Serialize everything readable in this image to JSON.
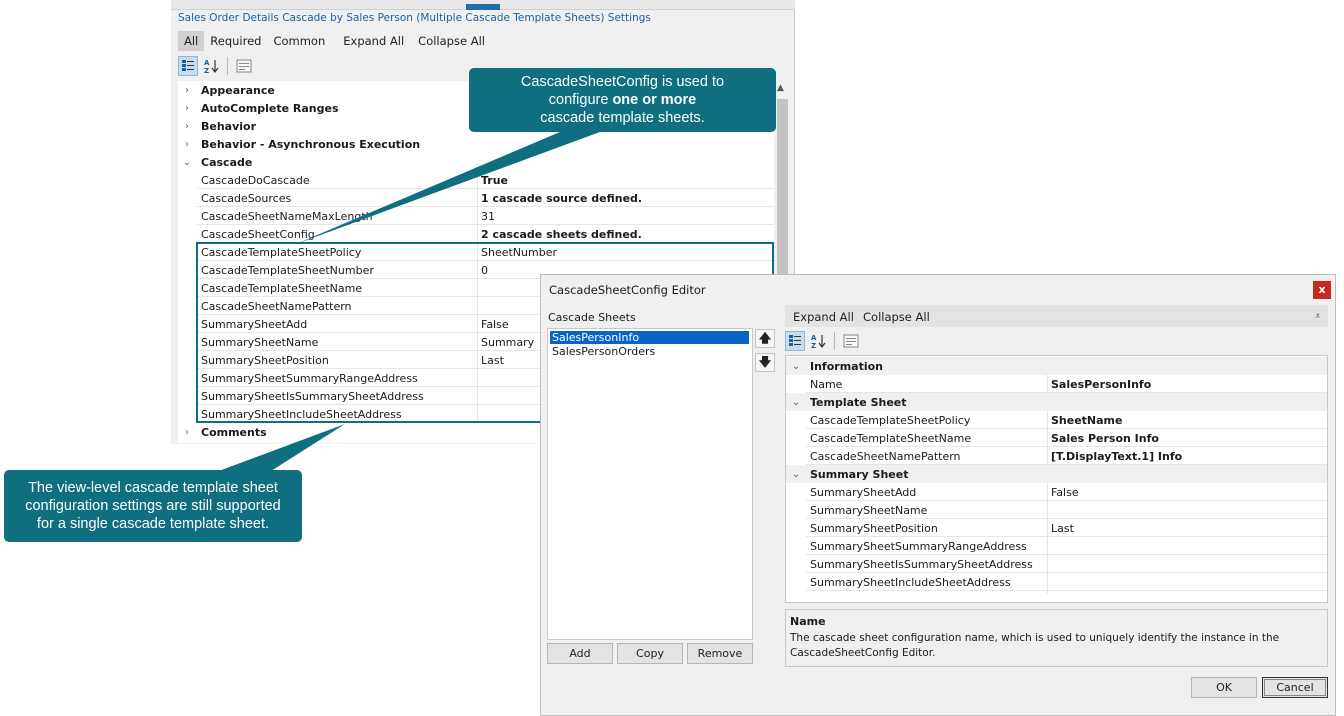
{
  "panel": {
    "title": "Sales Order Details Cascade by Sales Person (Multiple Cascade Template Sheets) Settings",
    "tabs": [
      "All",
      "Required",
      "Common",
      "Expand All",
      "Collapse All"
    ],
    "categories": {
      "appearance": "Appearance",
      "autocomplete": "AutoComplete Ranges",
      "behavior": "Behavior",
      "behavior_async": "Behavior - Asynchronous Execution",
      "cascade": "Cascade",
      "comments": "Comments"
    },
    "properties": [
      {
        "name": "CascadeDoCascade",
        "value": "True",
        "bold": true
      },
      {
        "name": "CascadeSources",
        "value": "1 cascade source defined.",
        "bold": true
      },
      {
        "name": "CascadeSheetNameMaxLength",
        "value": "31",
        "bold": false
      },
      {
        "name": "CascadeSheetConfig",
        "value": "2 cascade sheets defined.",
        "bold": true
      },
      {
        "name": "CascadeTemplateSheetPolicy",
        "value": "SheetNumber",
        "bold": false
      },
      {
        "name": "CascadeTemplateSheetNumber",
        "value": "0",
        "bold": false
      },
      {
        "name": "CascadeTemplateSheetName",
        "value": "",
        "bold": false
      },
      {
        "name": "CascadeSheetNamePattern",
        "value": "",
        "bold": false
      },
      {
        "name": "SummarySheetAdd",
        "value": "False",
        "bold": false
      },
      {
        "name": "SummarySheetName",
        "value": "Summary",
        "bold": false
      },
      {
        "name": "SummarySheetPosition",
        "value": "Last",
        "bold": false
      },
      {
        "name": "SummarySheetSummaryRangeAddress",
        "value": "",
        "bold": false
      },
      {
        "name": "SummarySheetIsSummarySheetAddress",
        "value": "",
        "bold": false
      },
      {
        "name": "SummarySheetIncludeSheetAddress",
        "value": "",
        "bold": false
      }
    ]
  },
  "callouts": {
    "top_line1": "CascadeSheetConfig is used to",
    "top_line2_pre": "configure ",
    "top_line2_bold": "one or more",
    "top_line3": "cascade template sheets.",
    "bottom_line1": "The view-level cascade template sheet",
    "bottom_line2": "configuration settings are still supported",
    "bottom_line3": "for a single cascade template sheet."
  },
  "dialog": {
    "title": "CascadeSheetConfig Editor",
    "close_label": "x",
    "list_label": "Cascade Sheets",
    "sheets": [
      "SalesPersonInfo",
      "SalesPersonOrders"
    ],
    "add_label": "Add",
    "copy_label": "Copy",
    "remove_label": "Remove",
    "expand_all": "Expand All",
    "collapse_all": "Collapse All",
    "categories": {
      "information": "Information",
      "template_sheet": "Template Sheet",
      "summary_sheet": "Summary Sheet"
    },
    "info_props": [
      {
        "name": "Name",
        "value": "SalesPersonInfo",
        "bold": true
      }
    ],
    "template_props": [
      {
        "name": "CascadeTemplateSheetPolicy",
        "value": "SheetName",
        "bold": true
      },
      {
        "name": "CascadeTemplateSheetName",
        "value": "Sales Person Info",
        "bold": true
      },
      {
        "name": "CascadeSheetNamePattern",
        "value": "[T.DisplayText.1] Info",
        "bold": true
      }
    ],
    "summary_props": [
      {
        "name": "SummarySheetAdd",
        "value": "False",
        "bold": false
      },
      {
        "name": "SummarySheetName",
        "value": "",
        "bold": false
      },
      {
        "name": "SummarySheetPosition",
        "value": "Last",
        "bold": false
      },
      {
        "name": "SummarySheetSummaryRangeAddress",
        "value": "",
        "bold": false
      },
      {
        "name": "SummarySheetIsSummarySheetAddress",
        "value": "",
        "bold": false
      },
      {
        "name": "SummarySheetIncludeSheetAddress",
        "value": "",
        "bold": false
      }
    ],
    "desc_title": "Name",
    "desc_text_1": "The cascade sheet configuration name, which is used to uniquely identify the instance in the",
    "desc_text_2": "CascadeSheetConfig Editor.",
    "ok_label": "OK",
    "cancel_label": "Cancel"
  },
  "colors": {
    "callout": "#0f6f80",
    "link_title": "#1e5f99",
    "selection": "#0a64c8",
    "close": "#c42b1c"
  }
}
